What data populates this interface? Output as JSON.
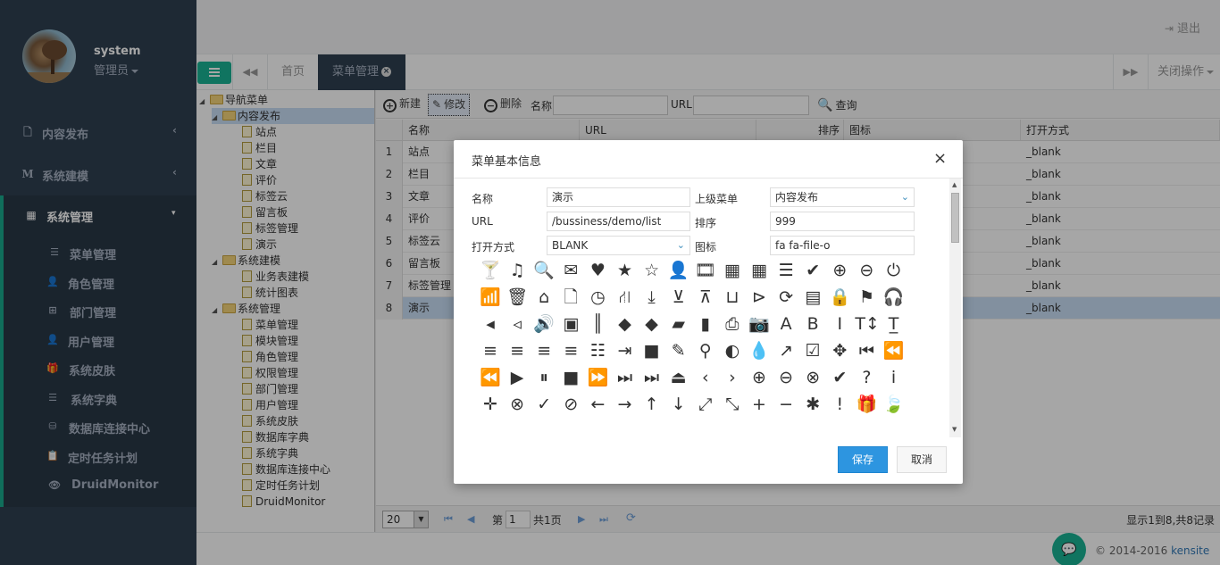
{
  "sidebar": {
    "username": "system",
    "role": "管理员",
    "menus": [
      {
        "label": "内容发布",
        "icon": "file-icon"
      },
      {
        "label": "系统建模",
        "icon": "m-icon"
      },
      {
        "label": "系统管理",
        "icon": "grid-icon"
      }
    ],
    "sub_items": [
      {
        "label": "菜单管理",
        "icon": "list-icon"
      },
      {
        "label": "角色管理",
        "icon": "user-icon"
      },
      {
        "label": "部门管理",
        "icon": "sitemap-icon"
      },
      {
        "label": "用户管理",
        "icon": "user-icon"
      },
      {
        "label": "系统皮肤",
        "icon": "gift-icon"
      },
      {
        "label": "系统字典",
        "icon": "list-icon"
      },
      {
        "label": "数据库连接中心",
        "icon": "database-icon"
      },
      {
        "label": "定时任务计划",
        "icon": "clipboard-icon"
      },
      {
        "label": "DruidMonitor",
        "icon": "eye-icon"
      }
    ]
  },
  "header": {
    "logout": "退出"
  },
  "tabs": {
    "home": "首页",
    "active": "菜单管理",
    "close_ops": "关闭操作"
  },
  "tree": {
    "root": "导航菜单",
    "nodes": [
      {
        "label": "内容发布",
        "kind": "folder"
      },
      {
        "label": "站点",
        "kind": "file"
      },
      {
        "label": "栏目",
        "kind": "file"
      },
      {
        "label": "文章",
        "kind": "file"
      },
      {
        "label": "评价",
        "kind": "file"
      },
      {
        "label": "标签云",
        "kind": "file"
      },
      {
        "label": "留言板",
        "kind": "file"
      },
      {
        "label": "标签管理",
        "kind": "file"
      },
      {
        "label": "演示",
        "kind": "file"
      },
      {
        "label": "系统建模",
        "kind": "folder"
      },
      {
        "label": "业务表建模",
        "kind": "file"
      },
      {
        "label": "统计图表",
        "kind": "file"
      },
      {
        "label": "系统管理",
        "kind": "folder"
      },
      {
        "label": "菜单管理",
        "kind": "file"
      },
      {
        "label": "模块管理",
        "kind": "file"
      },
      {
        "label": "角色管理",
        "kind": "file"
      },
      {
        "label": "权限管理",
        "kind": "file"
      },
      {
        "label": "部门管理",
        "kind": "file"
      },
      {
        "label": "用户管理",
        "kind": "file"
      },
      {
        "label": "系统皮肤",
        "kind": "file"
      },
      {
        "label": "数据库字典",
        "kind": "file"
      },
      {
        "label": "系统字典",
        "kind": "file"
      },
      {
        "label": "数据库连接中心",
        "kind": "file"
      },
      {
        "label": "定时任务计划",
        "kind": "file"
      },
      {
        "label": "DruidMonitor",
        "kind": "file"
      }
    ]
  },
  "toolbar": {
    "new": "新建",
    "edit": "修改",
    "delete": "删除",
    "name_label": "名称",
    "url_label": "URL",
    "search": "查询"
  },
  "grid": {
    "columns": [
      "名称",
      "URL",
      "排序",
      "图标",
      "打开方式"
    ],
    "rows": [
      {
        "num": "1",
        "name": "站点",
        "open": "_blank"
      },
      {
        "num": "2",
        "name": "栏目",
        "open": "_blank"
      },
      {
        "num": "3",
        "name": "文章",
        "open": "_blank"
      },
      {
        "num": "4",
        "name": "评价",
        "open": "_blank"
      },
      {
        "num": "5",
        "name": "标签云",
        "open": "_blank"
      },
      {
        "num": "6",
        "name": "留言板",
        "open": "_blank"
      },
      {
        "num": "7",
        "name": "标签管理",
        "open": "_blank"
      },
      {
        "num": "8",
        "name": "演示",
        "open": "_blank"
      }
    ]
  },
  "pager": {
    "page_size": "20",
    "page_prefix": "第",
    "page": "1",
    "total_pages": "共1页",
    "info": "显示1到8,共8记录"
  },
  "footer": {
    "copyright": "© 2014-2016",
    "brand": "kensite"
  },
  "modal": {
    "title": "菜单基本信息",
    "fields": {
      "name_label": "名称",
      "name_value": "演示",
      "parent_label": "上级菜单",
      "parent_value": "内容发布",
      "url_label": "URL",
      "url_value": "/bussiness/demo/list",
      "sort_label": "排序",
      "sort_value": "999",
      "open_label": "打开方式",
      "open_value": "BLANK",
      "icon_label": "图标",
      "icon_value": "fa fa-file-o"
    },
    "save": "保存",
    "cancel": "取消"
  },
  "icon_picker": [
    "glass-icon",
    "music-icon",
    "search-icon",
    "envelope-icon",
    "heart-icon",
    "star-icon",
    "star-o-icon",
    "user-icon",
    "film-icon",
    "th-large-icon",
    "th-icon",
    "th-list-icon",
    "check-icon",
    "zoom-in-icon",
    "zoom-out-icon",
    "power-icon",
    "signal-icon",
    "trash-icon",
    "home-icon",
    "file-o-icon",
    "clock-icon",
    "road-icon",
    "download-icon",
    "arrow-circle-down-icon",
    "arrow-circle-up-icon",
    "inbox-icon",
    "play-circle-icon",
    "refresh-icon",
    "list-alt-icon",
    "lock-icon",
    "flag-icon",
    "headphones-icon",
    "volume-off-icon",
    "volume-down-icon",
    "volume-up-icon",
    "qrcode-icon",
    "barcode-icon",
    "tag-icon",
    "tags-icon",
    "book-icon",
    "bookmark-icon",
    "print-icon",
    "camera-icon",
    "font-icon",
    "bold-icon",
    "italic-icon",
    "text-height-icon",
    "text-width-icon",
    "align-left-icon",
    "align-center-icon",
    "align-right-icon",
    "align-justify-icon",
    "list-icon",
    "indent-icon",
    "video-icon",
    "pencil-icon",
    "map-marker-icon",
    "adjust-icon",
    "tint-icon",
    "share-icon",
    "check-square-icon",
    "arrows-icon",
    "step-backward-icon",
    "fast-backward-icon",
    "backward-icon",
    "play-icon",
    "pause-icon",
    "stop-icon",
    "forward-icon",
    "fast-forward-icon",
    "step-forward-icon",
    "eject-icon",
    "chevron-left-icon",
    "chevron-right-icon",
    "plus-circle-icon",
    "minus-circle-icon",
    "times-circle-icon",
    "check-circle-icon",
    "question-circle-icon",
    "info-circle-icon",
    "crosshairs-icon",
    "times-circle-o-icon",
    "check-circle-o-icon",
    "ban-icon",
    "arrow-left-icon",
    "arrow-right-icon",
    "arrow-up-icon",
    "arrow-down-icon",
    "expand-icon",
    "compress-icon",
    "plus-icon",
    "minus-icon",
    "asterisk-icon",
    "exclamation-circle-icon",
    "gift-icon",
    "leaf-icon"
  ],
  "icon_glyphs": [
    "🍸",
    "♫",
    "🔍",
    "✉",
    "♥",
    "★",
    "☆",
    "👤",
    "🎞",
    "▦",
    "▦",
    "☰",
    "✔",
    "⊕",
    "⊖",
    "⏻",
    "📶",
    "🗑",
    "⌂",
    "🗋",
    "◷",
    "⛙",
    "⤓",
    "⊻",
    "⊼",
    "⊔",
    "⊳",
    "⟳",
    "▤",
    "🔒",
    "⚑",
    "🎧",
    "◂",
    "◃",
    "🔊",
    "▣",
    "║",
    "◆",
    "◆",
    "▰",
    "▮",
    "⎙",
    "📷",
    "A",
    "B",
    "I",
    "T↕",
    "T̲",
    "≡",
    "≡",
    "≡",
    "≡",
    "☷",
    "⇥",
    "■",
    "✎",
    "⚲",
    "◐",
    "💧",
    "↗",
    "☑",
    "✥",
    "⏮",
    "⏪",
    "⏪",
    "▶",
    "⏸",
    "■",
    "⏩",
    "⏭",
    "⏭",
    "⏏",
    "‹",
    "›",
    "⊕",
    "⊖",
    "⊗",
    "✔",
    "?",
    "i",
    "✛",
    "⊗",
    "✓",
    "⊘",
    "←",
    "→",
    "↑",
    "↓",
    "⤢",
    "⤡",
    "+",
    "−",
    "✱",
    "!",
    "🎁",
    "🍃"
  ]
}
